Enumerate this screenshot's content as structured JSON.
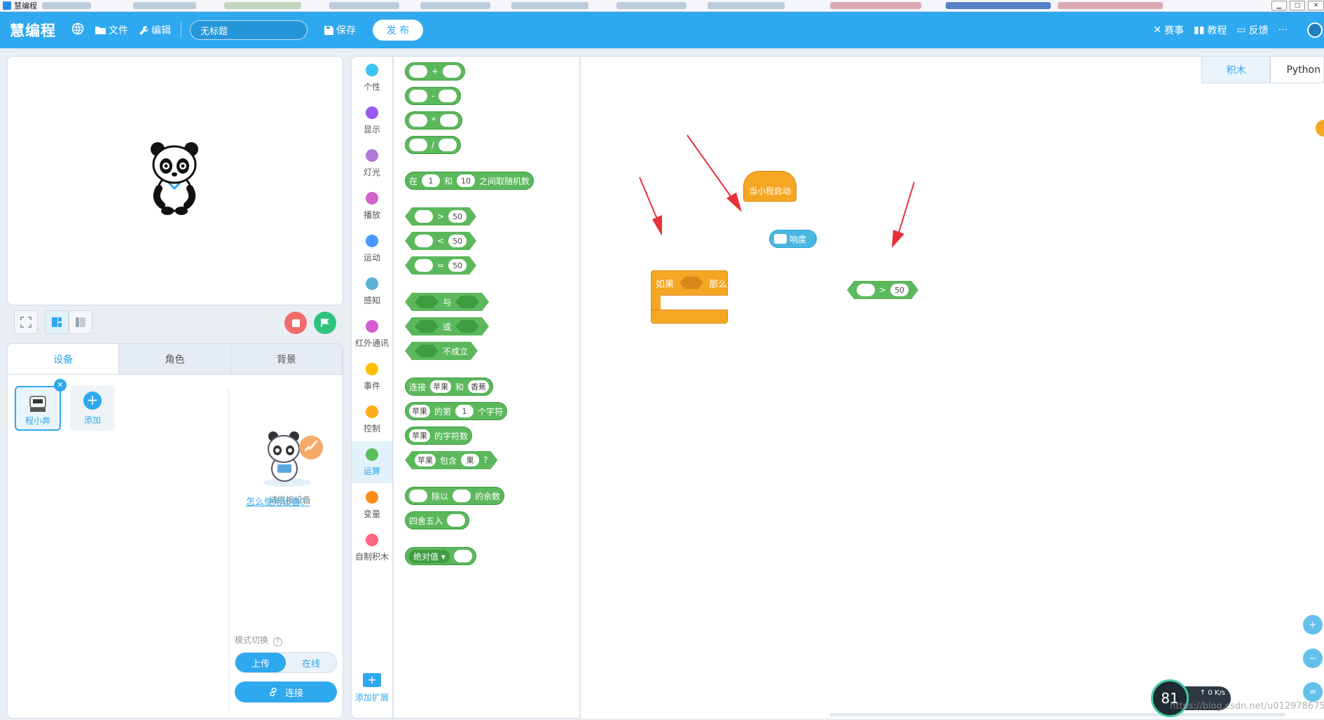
{
  "titlebar": {
    "title": "慧编程"
  },
  "toolbar": {
    "logo": "慧编程",
    "file": "文件",
    "edit": "编辑",
    "project_name": "无标题",
    "save": "保存",
    "publish": "发 布",
    "events": "赛事",
    "tutorial": "教程",
    "feedback": "反馈",
    "more": "···"
  },
  "device_panel": {
    "tabs": [
      "设备",
      "角色",
      "背景"
    ],
    "device_name": "程小奔",
    "add_label": "添加",
    "hint": "请连接设备",
    "howto": "怎么使用设备？",
    "mode_label": "模式切换",
    "mode_upload": "上传",
    "mode_online": "在线",
    "connect": "连接"
  },
  "categories": [
    {
      "label": "个性",
      "color": "#3ec3f0"
    },
    {
      "label": "显示",
      "color": "#9b59f0"
    },
    {
      "label": "灯光",
      "color": "#b07ad8"
    },
    {
      "label": "播放",
      "color": "#cf63cf"
    },
    {
      "label": "运动",
      "color": "#4c97ff"
    },
    {
      "label": "感知",
      "color": "#5cb1d6"
    },
    {
      "label": "红外通讯",
      "color": "#d65cd6"
    },
    {
      "label": "事件",
      "color": "#ffbf00"
    },
    {
      "label": "控制",
      "color": "#ffab19"
    },
    {
      "label": "运算",
      "color": "#59c059"
    },
    {
      "label": "变量",
      "color": "#ff8c1a"
    },
    {
      "label": "自制积木",
      "color": "#ff6680"
    }
  ],
  "extension": "添加扩展",
  "palette": {
    "ops": [
      "+",
      "-",
      "*",
      "/"
    ],
    "random": {
      "pre": "在",
      "a": "1",
      "mid": "和",
      "b": "10",
      "post": "之间取随机数"
    },
    "compare": [
      ">",
      "<",
      "="
    ],
    "compare_value": "50",
    "logic": [
      "与",
      "或",
      "不成立"
    ],
    "join": {
      "pre": "连接",
      "a": "苹果",
      "mid": "和",
      "b": "香蕉"
    },
    "letter": {
      "a": "苹果",
      "mid": "的第",
      "n": "1",
      "post": "个字符"
    },
    "length": {
      "a": "苹果",
      "post": "的字符数"
    },
    "contains": {
      "a": "苹果",
      "mid": "包含",
      "b": "果",
      "post": "?"
    },
    "mod": {
      "mid": "除以",
      "post": "的余数"
    },
    "round": "四舍五入",
    "abs": "绝对值 ▾"
  },
  "workspace": {
    "tabs": [
      "积木",
      "Python"
    ],
    "hat_block": "当小程启动",
    "sound_block": "响度",
    "if_block": {
      "pre": "如果",
      "post": "那么"
    },
    "compare_block": {
      "op": ">",
      "value": "50"
    }
  },
  "status": {
    "gauge": "81",
    "net_up": "0",
    "net_unit": "K/s",
    "watermark": "https://blog.csdn.net/u012978675"
  }
}
